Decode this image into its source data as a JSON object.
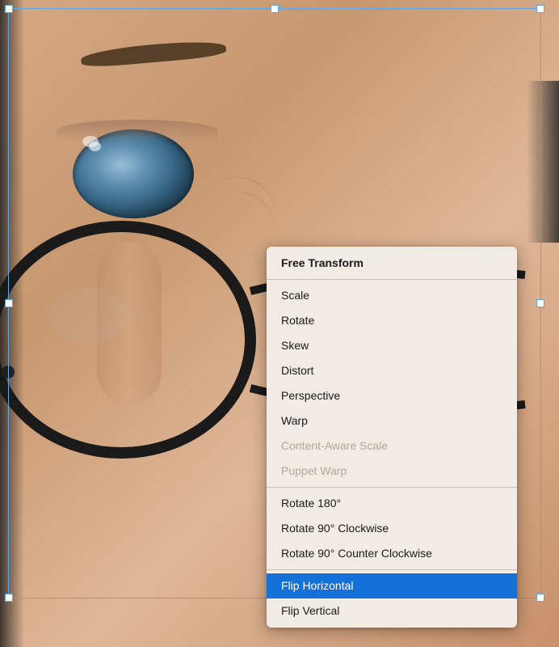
{
  "photo": {
    "alt": "Close-up face with glasses"
  },
  "selection": {
    "visible": true
  },
  "contextMenu": {
    "items": [
      {
        "id": "free-transform",
        "label": "Free Transform",
        "bold": true,
        "disabled": false,
        "highlighted": false,
        "separator_after": false
      },
      {
        "id": "separator-1",
        "type": "separator"
      },
      {
        "id": "scale",
        "label": "Scale",
        "bold": false,
        "disabled": false,
        "highlighted": false,
        "separator_after": false
      },
      {
        "id": "rotate",
        "label": "Rotate",
        "bold": false,
        "disabled": false,
        "highlighted": false,
        "separator_after": false
      },
      {
        "id": "skew",
        "label": "Skew",
        "bold": false,
        "disabled": false,
        "highlighted": false,
        "separator_after": false
      },
      {
        "id": "distort",
        "label": "Distort",
        "bold": false,
        "disabled": false,
        "highlighted": false,
        "separator_after": false
      },
      {
        "id": "perspective",
        "label": "Perspective",
        "bold": false,
        "disabled": false,
        "highlighted": false,
        "separator_after": false
      },
      {
        "id": "warp",
        "label": "Warp",
        "bold": false,
        "disabled": false,
        "highlighted": false,
        "separator_after": false
      },
      {
        "id": "content-aware-scale",
        "label": "Content-Aware Scale",
        "bold": false,
        "disabled": true,
        "highlighted": false,
        "separator_after": false
      },
      {
        "id": "puppet-warp",
        "label": "Puppet Warp",
        "bold": false,
        "disabled": true,
        "highlighted": false,
        "separator_after": false
      },
      {
        "id": "separator-2",
        "type": "separator"
      },
      {
        "id": "rotate-180",
        "label": "Rotate 180°",
        "bold": false,
        "disabled": false,
        "highlighted": false,
        "separator_after": false
      },
      {
        "id": "rotate-90-cw",
        "label": "Rotate 90° Clockwise",
        "bold": false,
        "disabled": false,
        "highlighted": false,
        "separator_after": false
      },
      {
        "id": "rotate-90-ccw",
        "label": "Rotate 90° Counter Clockwise",
        "bold": false,
        "disabled": false,
        "highlighted": false,
        "separator_after": false
      },
      {
        "id": "separator-3",
        "type": "separator"
      },
      {
        "id": "flip-horizontal",
        "label": "Flip Horizontal",
        "bold": false,
        "disabled": false,
        "highlighted": true,
        "separator_after": false
      },
      {
        "id": "flip-vertical",
        "label": "Flip Vertical",
        "bold": false,
        "disabled": false,
        "highlighted": false,
        "separator_after": false
      }
    ]
  }
}
